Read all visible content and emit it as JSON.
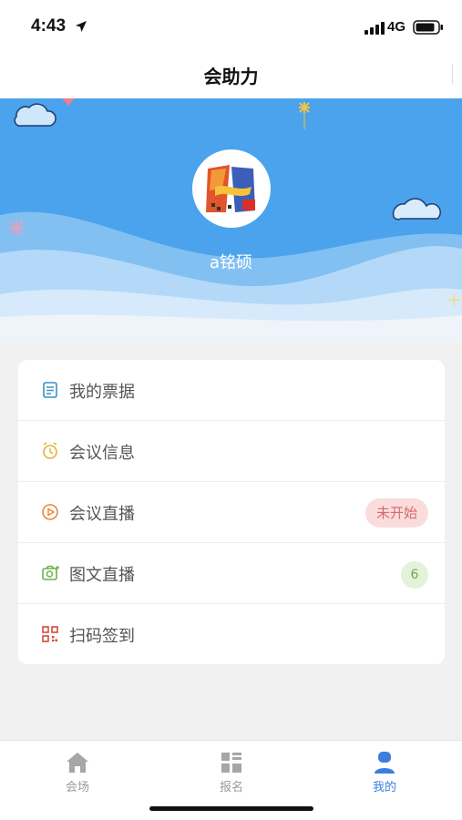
{
  "status_bar": {
    "time": "4:43",
    "network": "4G"
  },
  "header": {
    "title": "会助力"
  },
  "profile": {
    "username": "a铭硕"
  },
  "menu": {
    "items": [
      {
        "label": "我的票据",
        "icon": "ticket-icon"
      },
      {
        "label": "会议信息",
        "icon": "alarm-clock-icon"
      },
      {
        "label": "会议直播",
        "icon": "play-circle-icon",
        "badge": "未开始"
      },
      {
        "label": "图文直播",
        "icon": "camera-icon",
        "count": "6"
      },
      {
        "label": "扫码签到",
        "icon": "qr-code-icon"
      }
    ]
  },
  "tabbar": {
    "tabs": [
      {
        "label": "会场",
        "icon": "home-icon"
      },
      {
        "label": "报名",
        "icon": "grid-icon"
      },
      {
        "label": "我的",
        "icon": "user-icon",
        "active": true
      }
    ]
  },
  "colors": {
    "accent": "#3c7de0",
    "banner": "#4aa3ec",
    "badge_bg": "#fbdcdc",
    "badge_text": "#d46a6a",
    "count_bg": "#e3f2d9",
    "count_text": "#6fa64e"
  }
}
